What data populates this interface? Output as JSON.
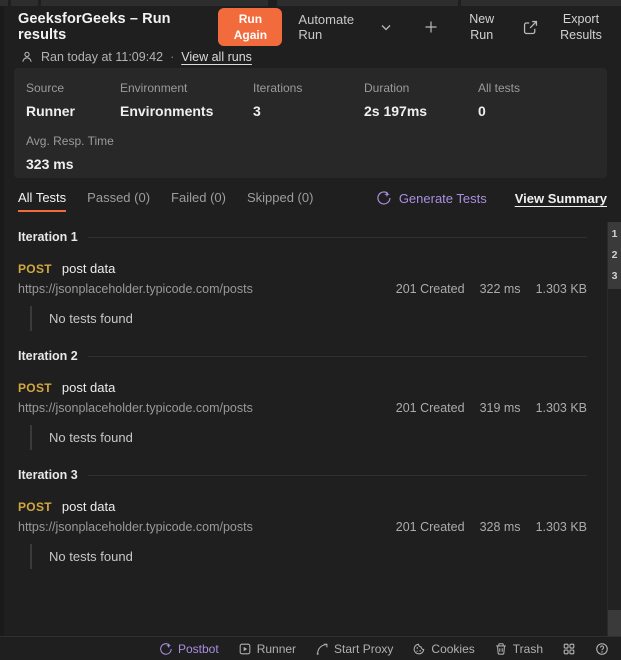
{
  "header": {
    "title": "GeeksforGeeks – Run results",
    "run_again": "Run Again",
    "automate_run": "Automate Run",
    "new_run": "New Run",
    "export_results": "Export Results",
    "ran_at": "Ran today at 11:09:42",
    "separator": "·",
    "view_all_runs": "View all runs"
  },
  "summary": {
    "columns": [
      {
        "label": "Source",
        "value": "Runner"
      },
      {
        "label": "Environment",
        "value": "Environments"
      },
      {
        "label": "Iterations",
        "value": "3"
      },
      {
        "label": "Duration",
        "value": "2s 197ms"
      },
      {
        "label": "All tests",
        "value": "0"
      }
    ],
    "avg_resp": {
      "label": "Avg. Resp. Time",
      "value": "323 ms"
    }
  },
  "tabs": [
    {
      "label": "All Tests",
      "active": true
    },
    {
      "label": "Passed (0)",
      "active": false
    },
    {
      "label": "Failed (0)",
      "active": false
    },
    {
      "label": "Skipped (0)",
      "active": false
    }
  ],
  "actions": {
    "generate_tests": "Generate Tests",
    "view_summary": "View Summary"
  },
  "iterations": [
    {
      "title": "Iteration 1",
      "method": "POST",
      "request_name": "post data",
      "url": "https://jsonplaceholder.typicode.com/posts",
      "status": "201 Created",
      "time": "322 ms",
      "size": "1.303 KB",
      "empty_message": "No tests found"
    },
    {
      "title": "Iteration 2",
      "method": "POST",
      "request_name": "post data",
      "url": "https://jsonplaceholder.typicode.com/posts",
      "status": "201 Created",
      "time": "319 ms",
      "size": "1.303 KB",
      "empty_message": "No tests found"
    },
    {
      "title": "Iteration 3",
      "method": "POST",
      "request_name": "post data",
      "url": "https://jsonplaceholder.typicode.com/posts",
      "status": "201 Created",
      "time": "328 ms",
      "size": "1.303 KB",
      "empty_message": "No tests found"
    }
  ],
  "scroll_markers": [
    "1",
    "2",
    "3"
  ],
  "statusbar": {
    "postbot": "Postbot",
    "runner": "Runner",
    "start_proxy": "Start Proxy",
    "cookies": "Cookies",
    "trash": "Trash"
  },
  "colors": {
    "accent_orange": "#f26b3c",
    "method_post": "#d3a73f",
    "accent_purple": "#a98ee0"
  }
}
